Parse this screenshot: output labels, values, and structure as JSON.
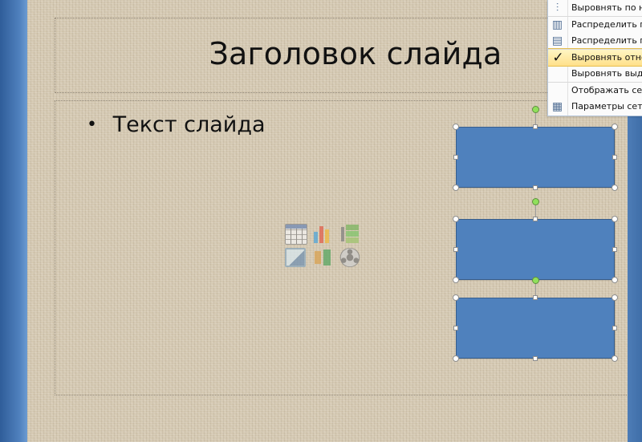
{
  "slide": {
    "title": "Заголовок слайда",
    "bullet_symbol": "•",
    "body_text": "Текст слайда"
  },
  "content_icons": [
    {
      "name": "table-icon"
    },
    {
      "name": "chart-icon"
    },
    {
      "name": "smartart-icon"
    },
    {
      "name": "picture-icon"
    },
    {
      "name": "clip-art-icon"
    },
    {
      "name": "media-clip-icon"
    }
  ],
  "context_menu": {
    "items": [
      {
        "label": "Выровнять по ниж",
        "icon": "align-bottom-icon",
        "glyph": "⫶"
      },
      {
        "label": "Распределить по го",
        "icon": "distribute-horizontally-icon",
        "glyph": "▥"
      },
      {
        "label": "Распределить по ве",
        "icon": "distribute-vertically-icon",
        "glyph": "▤"
      },
      {
        "label": "Выровнять относи",
        "icon": "check-icon",
        "glyph": "✓"
      },
      {
        "label": "Выровнять выделе",
        "icon": "",
        "glyph": ""
      },
      {
        "label": "Отображать сетку",
        "icon": "",
        "glyph": ""
      },
      {
        "label": "Параметры сетки...",
        "icon": "grid-settings-icon",
        "glyph": "▦"
      }
    ]
  },
  "colors": {
    "shape_fill": "#4f81bd",
    "shape_border": "#385d8a",
    "rotation_handle": "#90e05b",
    "menu_highlight": "#ffe08a"
  }
}
